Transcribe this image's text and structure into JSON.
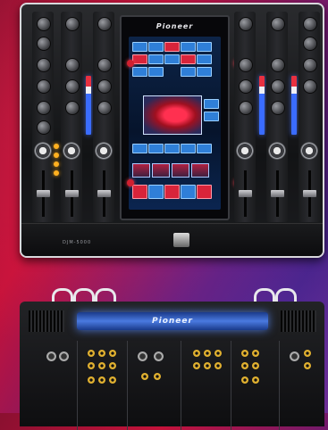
{
  "brand": {
    "front_logo": "Pioneer",
    "rear_logo": "Pioneer"
  },
  "model": "DJM-5000",
  "colors": {
    "background_red": "#c4123a",
    "background_purple": "#3a1c78",
    "meter_blue": "#3a6cff",
    "meter_red": "#e83040",
    "lcd_blue": "#2f7fd8",
    "jack_gold": "#e0b030"
  }
}
